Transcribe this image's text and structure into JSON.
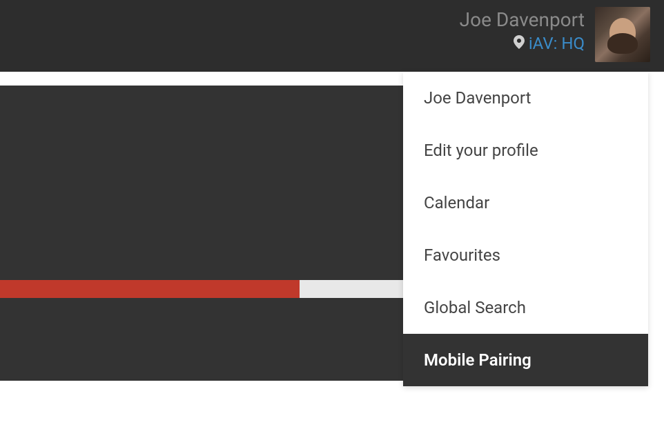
{
  "header": {
    "username": "Joe Davenport",
    "location_label": "iAV: HQ"
  },
  "dropdown": {
    "items": [
      {
        "label": "Joe Davenport",
        "selected": false
      },
      {
        "label": "Edit your profile",
        "selected": false
      },
      {
        "label": "Calendar",
        "selected": false
      },
      {
        "label": "Favourites",
        "selected": false
      },
      {
        "label": "Global Search",
        "selected": false
      },
      {
        "label": "Mobile Pairing",
        "selected": true
      }
    ]
  },
  "progress": {
    "percent": 47
  },
  "colors": {
    "header_bg": "#2d2d2d",
    "content_bg": "#333333",
    "progress_fill": "#c0392b",
    "location_link": "#3a8bc8"
  }
}
